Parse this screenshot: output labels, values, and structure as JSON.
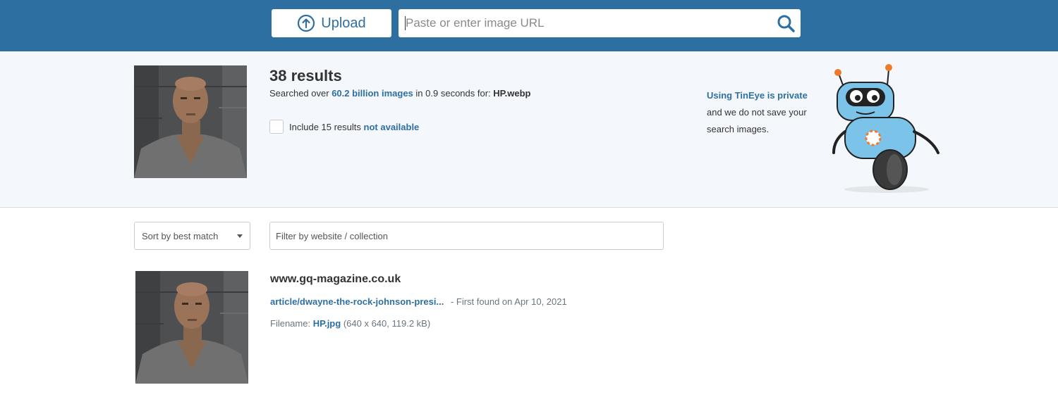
{
  "header": {
    "upload_label": "Upload",
    "search_placeholder": "Paste or enter image URL"
  },
  "summary": {
    "results_count": "38 results",
    "searched_prefix": "Searched over",
    "searched_link": "60.2 billion images",
    "searched_middle": "in 0.9 seconds for:",
    "filename": "HP.webp",
    "include_text": "Include 15 results",
    "include_link": "not available",
    "privacy_link": "Using TinEye is private",
    "privacy_line2": "and we do not save your",
    "privacy_line3": "search images."
  },
  "controls": {
    "sort_value": "Sort by best match",
    "filter_placeholder": "Filter by website / collection"
  },
  "results": [
    {
      "domain": "www.gq-magazine.co.uk",
      "path": "article/dwayne-the-rock-johnson-presi...",
      "found": "- First found on Apr 10, 2021",
      "filename_label": "Filename:",
      "filename": "HP.jpg",
      "details": "(640 x 640, 119.2 kB)"
    }
  ],
  "colors": {
    "header_bg": "#2e6fa2",
    "link": "#2e6fa2",
    "summary_bg": "#f4f8fc",
    "robot_body": "#7cc3ea",
    "robot_accent": "#f07a2b"
  }
}
